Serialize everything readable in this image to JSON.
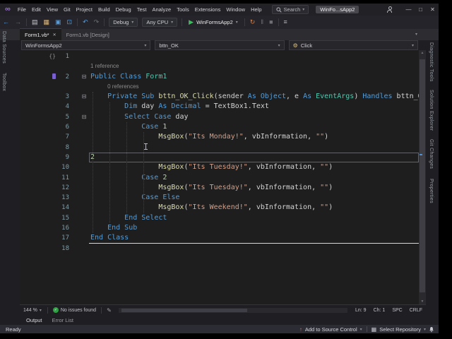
{
  "titlebar": {
    "title": "WinFo...sApp2",
    "search_label": "Search"
  },
  "menu": {
    "items": [
      "File",
      "Edit",
      "View",
      "Git",
      "Project",
      "Build",
      "Debug",
      "Test",
      "Analyze",
      "Tools",
      "Extensions",
      "Window",
      "Help"
    ]
  },
  "toolbar": {
    "debug_config": "Debug",
    "platform": "Any CPU",
    "run_target": "WinFormsApp2"
  },
  "tabs": [
    {
      "label": "Form1.vb*",
      "active": true
    },
    {
      "label": "Form1.vb [Design]",
      "active": false
    }
  ],
  "breadcrumb": {
    "scope": "WinFormsApp2",
    "member": "bttn_OK",
    "handler": "Click"
  },
  "side_left": [
    "Data Sources",
    "Toolbox"
  ],
  "side_right": [
    "Diagnostic Tools",
    "Solution Explorer",
    "Git Changes",
    "Properties"
  ],
  "editor": {
    "zoom": "144 %",
    "health": "No issues found",
    "ln": "Ln: 9",
    "ch": "Ch: 1",
    "spc": "SPC",
    "eol": "CRLF",
    "lines": [
      {
        "num": "1",
        "margin": "{}",
        "tokens": []
      },
      {
        "lens": "1 reference",
        "padc": 0
      },
      {
        "num": "2",
        "margin_icon": true,
        "fold": true,
        "tokens": [
          [
            "kw",
            "Public Class "
          ],
          [
            "ty",
            "Form1"
          ]
        ]
      },
      {
        "lens": "0 references",
        "padc": 4
      },
      {
        "num": "3",
        "fold": true,
        "tokens": [
          [
            "pl",
            "    "
          ],
          [
            "kw",
            "Private Sub "
          ],
          [
            "me",
            "bttn_OK_Click"
          ],
          [
            "pl",
            "(sender "
          ],
          [
            "kw",
            "As "
          ],
          [
            "kw",
            "Object"
          ],
          [
            "pl",
            ", e "
          ],
          [
            "kw",
            "As "
          ],
          [
            "ty",
            "EventArgs"
          ],
          [
            "pl",
            ") "
          ],
          [
            "kw",
            "Handles"
          ],
          [
            "pl",
            " bttn_OK.Click"
          ]
        ]
      },
      {
        "num": "4",
        "tokens": [
          [
            "pl",
            "        "
          ],
          [
            "kw",
            "Dim "
          ],
          [
            "pl",
            "day "
          ],
          [
            "kw",
            "As "
          ],
          [
            "kw",
            "Decimal"
          ],
          [
            "pl",
            " = TextBox1.Text"
          ]
        ]
      },
      {
        "num": "5",
        "fold": true,
        "tokens": [
          [
            "pl",
            "        "
          ],
          [
            "kw",
            "Select Case "
          ],
          [
            "pl",
            "day"
          ]
        ]
      },
      {
        "num": "6",
        "tokens": [
          [
            "pl",
            "            "
          ],
          [
            "kw",
            "Case "
          ],
          [
            "nu",
            "1"
          ]
        ]
      },
      {
        "num": "7",
        "tokens": [
          [
            "pl",
            "                "
          ],
          [
            "me",
            "MsgBox"
          ],
          [
            "pl",
            "("
          ],
          [
            "st",
            "\"Its Monday!\""
          ],
          [
            "pl",
            ", vbInformation, "
          ],
          [
            "st",
            "\"\""
          ],
          [
            "pl",
            ")"
          ]
        ]
      },
      {
        "num": "8",
        "tokens": []
      },
      {
        "num": "9",
        "current": true,
        "tokens": [
          [
            "nu",
            "2"
          ]
        ]
      },
      {
        "num": "10",
        "tokens": [
          [
            "pl",
            "                "
          ],
          [
            "me",
            "MsgBox"
          ],
          [
            "pl",
            "("
          ],
          [
            "st",
            "\"Its Tuesday!\""
          ],
          [
            "pl",
            ", vbInformation, "
          ],
          [
            "st",
            "\"\""
          ],
          [
            "pl",
            ")"
          ]
        ]
      },
      {
        "num": "11",
        "tokens": [
          [
            "pl",
            "            "
          ],
          [
            "kw",
            "Case "
          ],
          [
            "nu",
            "2"
          ]
        ]
      },
      {
        "num": "12",
        "tokens": [
          [
            "pl",
            "                "
          ],
          [
            "me",
            "MsgBox"
          ],
          [
            "pl",
            "("
          ],
          [
            "st",
            "\"Its Tuesday!\""
          ],
          [
            "pl",
            ", vbInformation, "
          ],
          [
            "st",
            "\"\""
          ],
          [
            "pl",
            ")"
          ]
        ]
      },
      {
        "num": "13",
        "tokens": [
          [
            "pl",
            "            "
          ],
          [
            "kw",
            "Case Else"
          ]
        ]
      },
      {
        "num": "14",
        "tokens": [
          [
            "pl",
            "                "
          ],
          [
            "me",
            "MsgBox"
          ],
          [
            "pl",
            "("
          ],
          [
            "st",
            "\"Its Weekend!\""
          ],
          [
            "pl",
            ", vbInformation, "
          ],
          [
            "st",
            "\"\""
          ],
          [
            "pl",
            ")"
          ]
        ]
      },
      {
        "num": "15",
        "tokens": [
          [
            "pl",
            "        "
          ],
          [
            "kw",
            "End Select"
          ]
        ]
      },
      {
        "num": "16",
        "tokens": [
          [
            "pl",
            "    "
          ],
          [
            "kw",
            "End Sub"
          ]
        ]
      },
      {
        "num": "17",
        "underline": true,
        "tokens": [
          [
            "kw",
            "End Class"
          ]
        ]
      },
      {
        "num": "18",
        "tokens": []
      }
    ]
  },
  "panel_tabs": [
    "Output",
    "Error List"
  ],
  "status": {
    "ready": "Ready",
    "add_source_control": "Add to Source Control",
    "select_repository": "Select Repository"
  },
  "colors": {
    "keyword": "#569CD6",
    "type": "#4EC9B0",
    "method": "#DCDCAA",
    "string": "#D69D85",
    "number": "#B5CEA8",
    "run_green": "#3fba5f",
    "editor_bg": "#1e1e1e"
  }
}
